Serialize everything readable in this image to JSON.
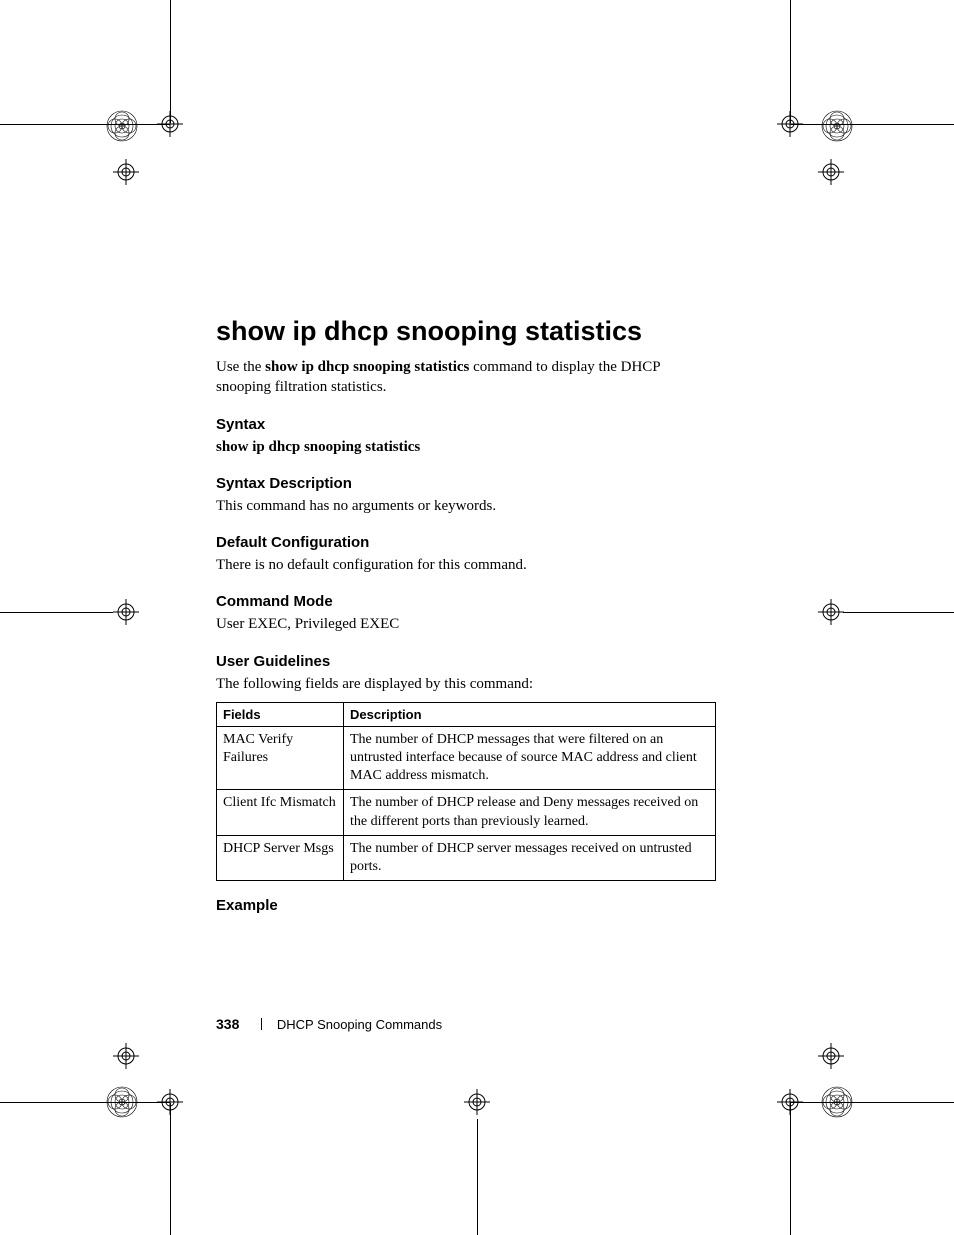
{
  "title": "show ip dhcp snooping statistics",
  "intro_prefix": "Use the ",
  "intro_bold": "show ip dhcp snooping statistics",
  "intro_suffix": " command to display the DHCP snooping filtration statistics.",
  "sections": {
    "syntax": {
      "heading": "Syntax",
      "body": "show ip dhcp snooping statistics"
    },
    "syntax_desc": {
      "heading": "Syntax Description",
      "body": "This command has no arguments or keywords."
    },
    "default_cfg": {
      "heading": "Default Configuration",
      "body": "There is no default configuration for this command."
    },
    "cmd_mode": {
      "heading": "Command Mode",
      "body": "User EXEC, Privileged EXEC"
    },
    "user_guidelines": {
      "heading": "User Guidelines",
      "body": "The following fields are displayed by this command:"
    },
    "example": {
      "heading": "Example"
    }
  },
  "table": {
    "headers": [
      "Fields",
      "Description"
    ],
    "rows": [
      [
        "MAC Verify Failures",
        "The number of DHCP messages that were filtered on an untrusted interface because of source MAC address and client MAC address mismatch."
      ],
      [
        "Client Ifc Mismatch",
        "The number of DHCP release and Deny messages received on the different ports than previously learned."
      ],
      [
        "DHCP Server Msgs",
        "The number of DHCP server messages received on untrusted ports."
      ]
    ]
  },
  "footer": {
    "page": "338",
    "chapter": "DHCP Snooping Commands"
  }
}
